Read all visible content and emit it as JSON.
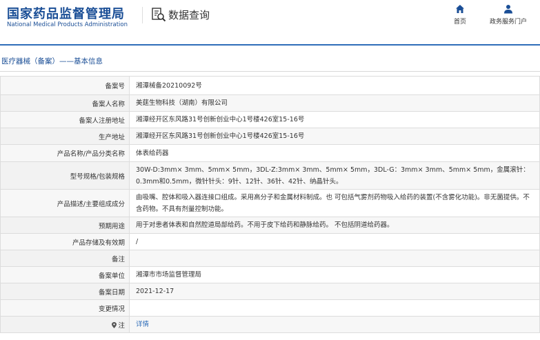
{
  "header": {
    "logo_cn": "国家药品监督管理局",
    "logo_en": "National Medical Products Administration",
    "query_title": "数据查询",
    "nav": {
      "home_label": "首页",
      "portal_label": "政务服务门户"
    }
  },
  "breadcrumb": "医疗器械（备案）——基本信息",
  "icons": {
    "query": "search-document-icon",
    "home": "home-icon",
    "portal": "user-icon",
    "note": "map-pin-icon"
  },
  "colors": {
    "brand": "#1a4e96",
    "accent_line": "#2e6cb8",
    "link": "#2e6cb8"
  },
  "rows": [
    {
      "label": "备案号",
      "value": "湘潭械备20210092号"
    },
    {
      "label": "备案人名称",
      "value": "美莛生物科技（湖南）有限公司"
    },
    {
      "label": "备案人注册地址",
      "value": "湘潭经开区东风路31号创新创业中心1号楼426室15-16号"
    },
    {
      "label": "生产地址",
      "value": "湘潭经开区东风路31号创新创业中心1号楼426室15-16号"
    },
    {
      "label": "产品名称/产品分类名称",
      "value": "体表给药器"
    },
    {
      "label": "型号规格/包装规格",
      "value": "30W-D:3mm× 3mm、5mm× 5mm，3DL-Z:3mm× 3mm、5mm× 5mm，3DL-G：3mm× 3mm、5mm× 5mm，金属滚针：0.3mm和0.5mm，微针针头：9针、12针、36针、42针、纳晶针头。"
    },
    {
      "label": "产品描述/主要组成成分",
      "value": "由吸嘴、腔体和吸入器连接口组成。采用高分子和金属材料制成。也 可包括气雾剂药物吸入给药的装置(不含雾化功能)。非无菌提供。不 含药物。不具有剂量控制功能。"
    },
    {
      "label": "预期用途",
      "value": "用于对患者体表和自然腔道局部给药。不用于皮下给药和静脉给药。 不包括阴道给药器。"
    },
    {
      "label": "产品存储及有效期",
      "value": "/"
    },
    {
      "label": "备注",
      "value": ""
    },
    {
      "label": "备案单位",
      "value": "湘潭市市场监督管理局"
    },
    {
      "label": "备案日期",
      "value": "2021-12-17"
    },
    {
      "label": "变更情况",
      "value": ""
    },
    {
      "label": "注",
      "value": "详情"
    }
  ]
}
